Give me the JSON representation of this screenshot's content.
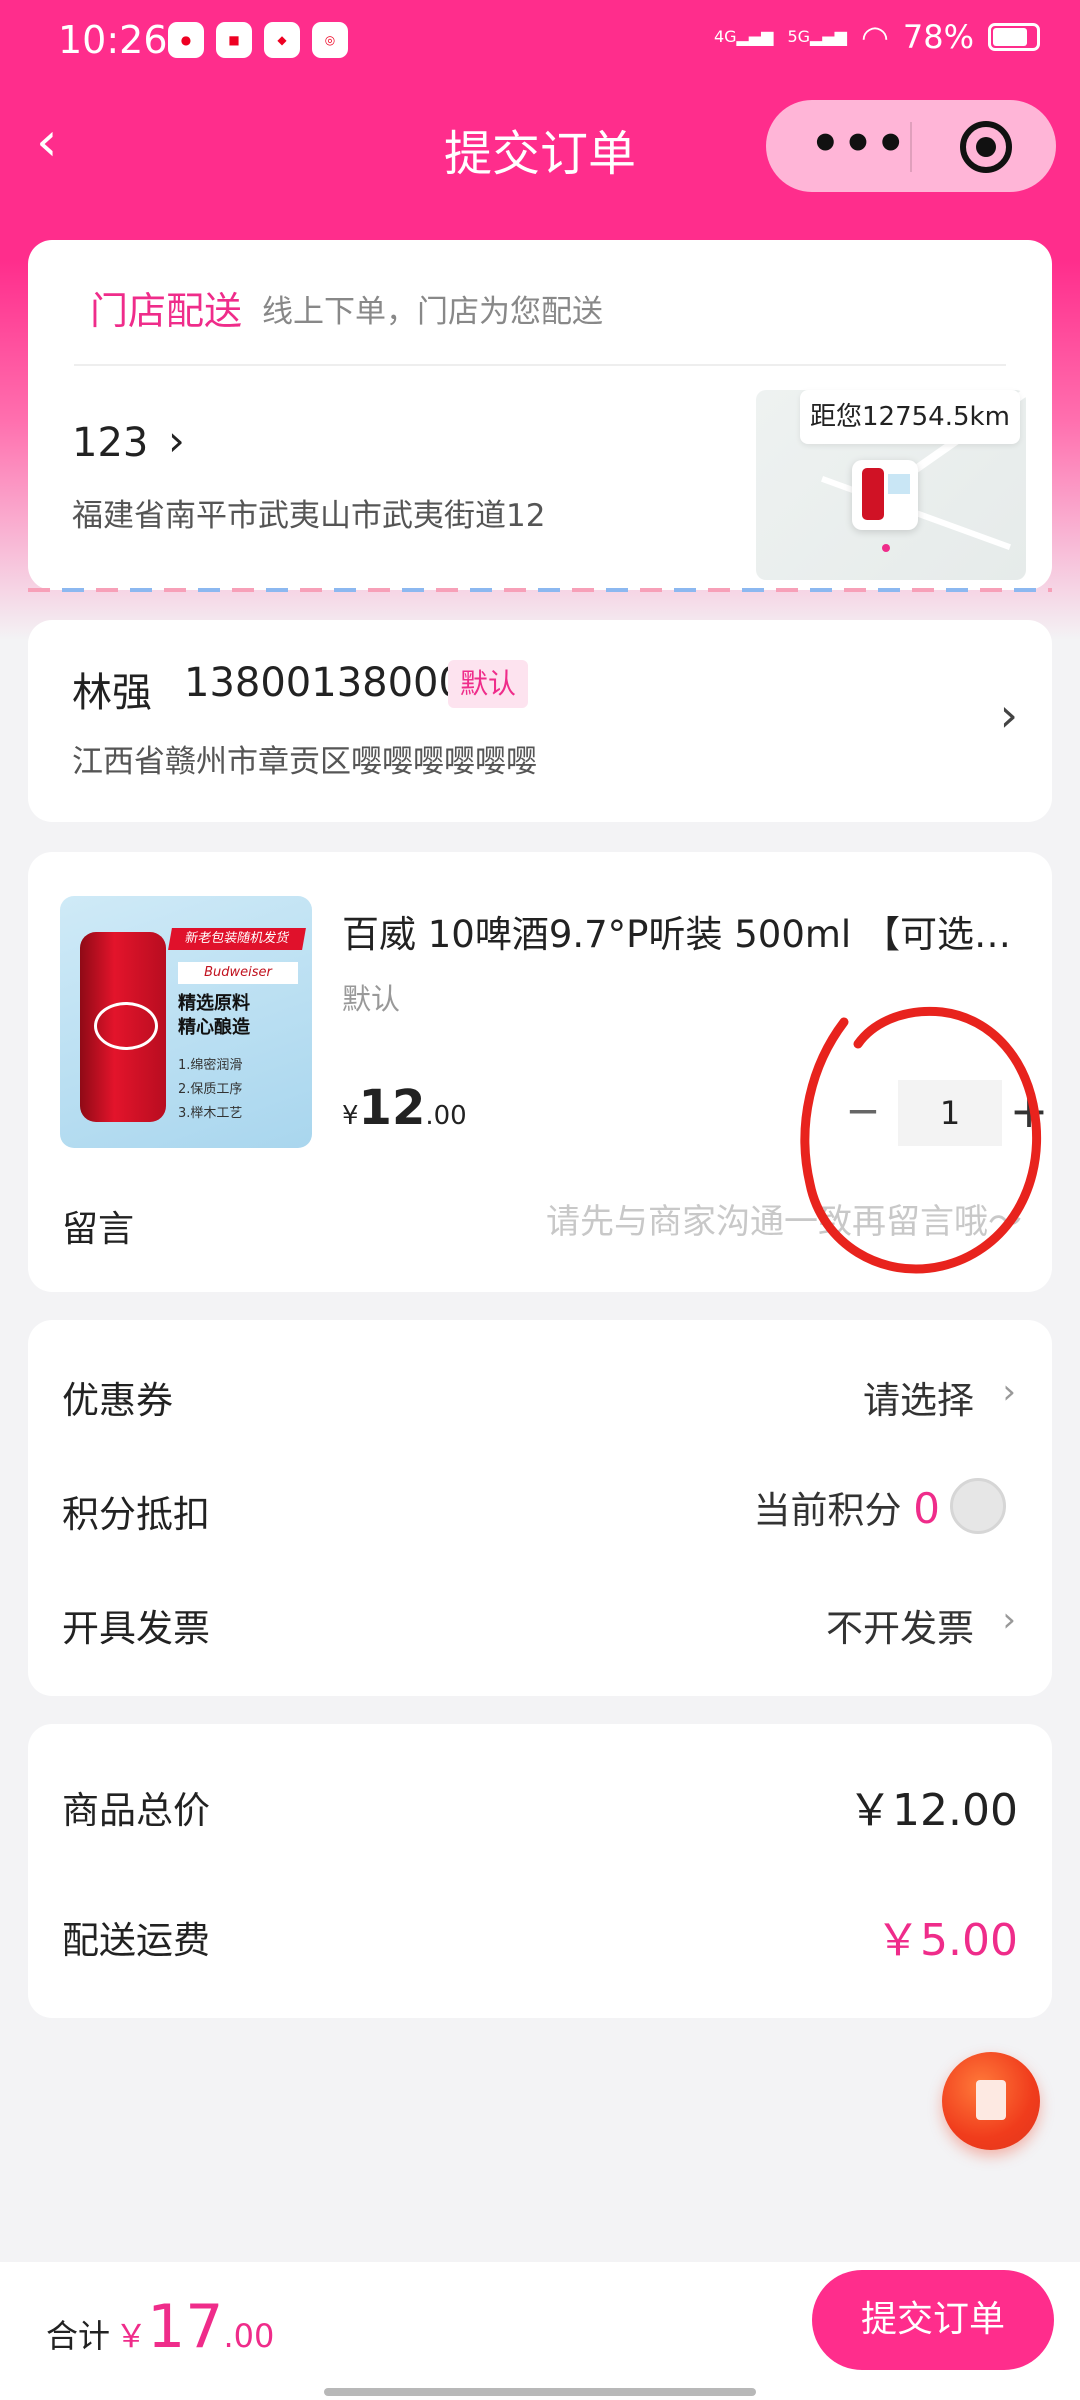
{
  "status_bar": {
    "time": "10:26",
    "network_4g": "4G",
    "network_5g": "5G",
    "battery": "78%"
  },
  "navbar": {
    "title": "提交订单",
    "more_icon": "more-dots-icon",
    "close_icon": "target-close-icon"
  },
  "delivery": {
    "mode": "门店配送",
    "mode_desc": "线上下单，门店为您配送",
    "store_name": "123",
    "store_address": "福建省南平市武夷山市武夷街道12",
    "distance": "距您12754.5km"
  },
  "contact": {
    "name": "林强",
    "phone": "13800138000",
    "tag": "默认",
    "address": "江西省赣州市章贡区嘤嘤嘤嘤嘤嘤"
  },
  "product": {
    "title": "百威 10啤酒9.7°P听装 500ml 【可选…",
    "spec": "默认",
    "price_currency": "¥",
    "price_int": "12",
    "price_dec": ".00",
    "quantity": "1",
    "image_banner": "新老包装随机发货",
    "image_brand": "Budweiser",
    "image_line1": "精选原料",
    "image_line2": "精心酿造",
    "image_list": [
      "1.绵密润滑",
      "2.保质工序",
      "3.榉木工艺"
    ],
    "message_label": "留言",
    "message_placeholder": "请先与商家沟通一致再留言哦～"
  },
  "options": {
    "coupon_label": "优惠券",
    "coupon_value": "请选择",
    "points_label": "积分抵扣",
    "points_text": "当前积分",
    "points_value": "0",
    "invoice_label": "开具发票",
    "invoice_value": "不开发票"
  },
  "summary": {
    "goods_label": "商品总价",
    "goods_value": "￥12.00",
    "shipping_label": "配送运费",
    "shipping_value": "￥5.00"
  },
  "footer": {
    "total_label": "合计",
    "total_currency": "￥",
    "total_int": "17",
    "total_dec": ".00",
    "submit_label": "提交订单"
  },
  "colors": {
    "accent": "#ff2d8c",
    "price_pink": "#ef2c8a",
    "annotation_red": "#e8231d"
  }
}
